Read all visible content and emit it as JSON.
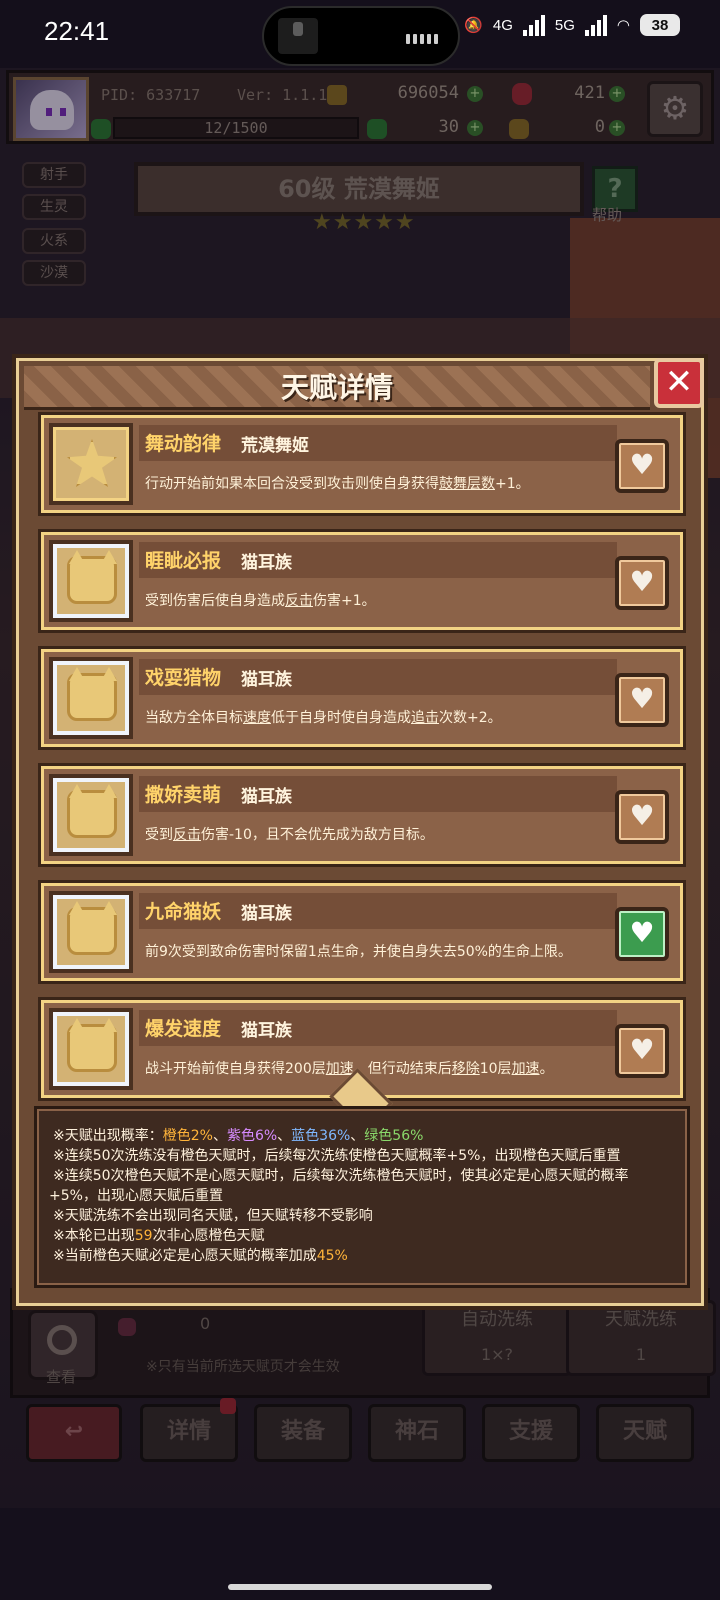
{
  "status": {
    "time": "22:41",
    "net1": "4G",
    "net2": "5G",
    "battery": "38"
  },
  "player": {
    "pid": "PID: 633717",
    "version": "Ver: 1.1.1.8",
    "gold": "696054",
    "gems": "421",
    "exp": "12/1500",
    "clover": "30",
    "potion": "0"
  },
  "tags": [
    "射手",
    "生灵",
    "火系",
    "沙漠"
  ],
  "character": {
    "title": "60级 荒漠舞姬",
    "stars": "★★★★★",
    "help_label": "帮助",
    "help_icon": "?"
  },
  "modal": {
    "title": "天赋详情",
    "close": "✕",
    "talents": [
      {
        "name": "舞动韵律",
        "tribe": "荒漠舞姬",
        "desc_parts": [
          "行动开始前如果本回合没受到攻击则使自身获得",
          "鼓舞层数",
          "+1。"
        ],
        "wish": false
      },
      {
        "name": "睚眦必报",
        "tribe": "猫耳族",
        "desc_parts": [
          "受到伤害后使自身造成",
          "反击",
          "伤害+1。"
        ],
        "wish": false
      },
      {
        "name": "戏耍猎物",
        "tribe": "猫耳族",
        "desc_parts": [
          "当敌方全体目标",
          "速度",
          "低于自身时使自身造成",
          "追击",
          "次数+2。"
        ],
        "wish": false
      },
      {
        "name": "撒娇卖萌",
        "tribe": "猫耳族",
        "desc_parts": [
          "受到",
          "反击",
          "伤害-10，且不会优先成为敌方目标。"
        ],
        "wish": false
      },
      {
        "name": "九命猫妖",
        "tribe": "猫耳族",
        "desc_parts": [
          "前9次受到致命伤害时保留1点生命，并使自身失去50%的生命上限。"
        ],
        "wish": true
      },
      {
        "name": "爆发速度",
        "tribe": "猫耳族",
        "desc_parts": [
          "战斗开始前使自身获得200层",
          "加速",
          "，但行动结束后",
          "移除",
          "10层",
          "加速",
          "。"
        ],
        "wish": false
      }
    ],
    "notes": {
      "rate_prefix": "※天赋出现概率：",
      "orange": "橙色2%",
      "sep1": "、",
      "purple": "紫色6%",
      "sep2": "、",
      "blue": "蓝色36%",
      "sep3": "、",
      "green": "绿色56%",
      "line2": "※连续50次洗练没有橙色天赋时，后续每次洗练使橙色天赋概率+5%，出现橙色天赋后重置",
      "line3a": "※连续50次橙色天赋不是心愿天赋时，后续每次洗练橙色天赋时，使其必定是心愿天赋的概率",
      "line3b": "+5%，出现心愿天赋后重置",
      "line4": "※天赋洗练不会出现同名天赋，但天赋转移不受影响",
      "line5_prefix": "※本轮已出现",
      "line5_value": "59",
      "line5_suffix": "次非心愿橙色天赋",
      "line6_prefix": "※当前橙色天赋必定是心愿天赋的概率加成",
      "line6_value": "45%"
    }
  },
  "bottom": {
    "search_label": "查看",
    "count": "0",
    "note": "※只有当前所选天赋页才会生效",
    "auto_refine": {
      "label": "自动洗练",
      "value": "1×?"
    },
    "talent_refine": {
      "label": "天赋洗练",
      "value": "1"
    }
  },
  "nav": {
    "back": "↩",
    "details": "详情",
    "equip": "装备",
    "stone": "神石",
    "support": "支援",
    "talent": "天赋"
  },
  "colors": {
    "wish_green": "#3c9c4f",
    "accent_orange": "#ffb43a",
    "frame_gold": "#f3d384"
  }
}
